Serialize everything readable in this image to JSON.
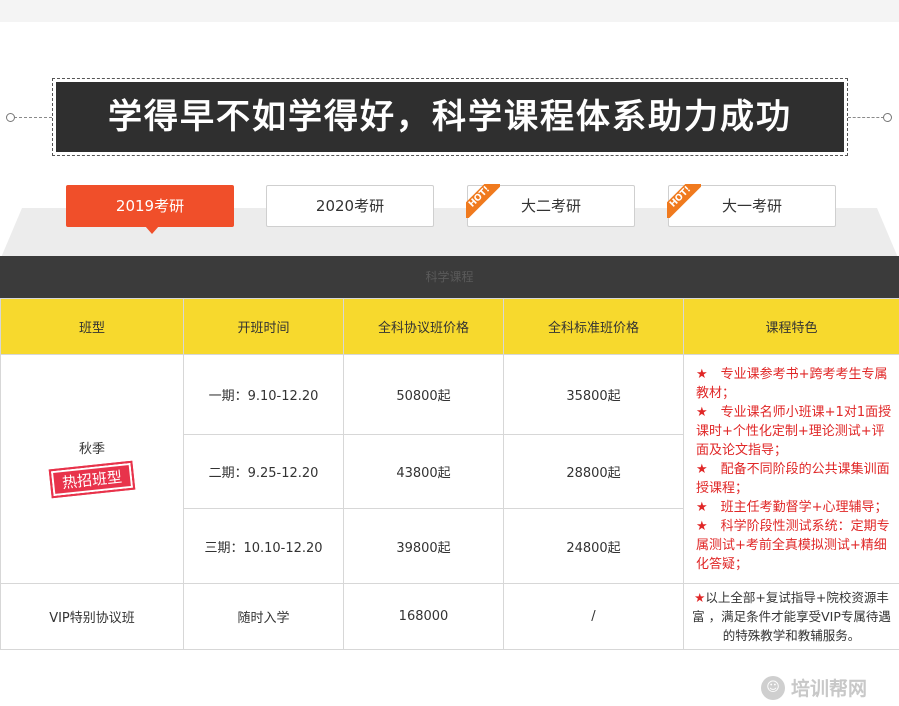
{
  "banner": {
    "title": "学得早不如学得好，科学课程体系助力成功"
  },
  "tabs": [
    {
      "label": "2019考研",
      "active": true,
      "hot": false
    },
    {
      "label": "2020考研",
      "active": false,
      "hot": false
    },
    {
      "label": "大二考研",
      "active": false,
      "hot": true
    },
    {
      "label": "大一考研",
      "active": false,
      "hot": true
    }
  ],
  "hot_badge": "HOT!",
  "section": {
    "title": "科学课程"
  },
  "table": {
    "headers": [
      "班型",
      "开班时间",
      "全科协议班价格",
      "全科标准班价格",
      "课程特色"
    ],
    "season": {
      "label": "秋季",
      "stamp": "热招班型"
    },
    "rows": [
      {
        "time": "一期：9.10-12.20",
        "protocol_price": "50800起",
        "standard_price": "35800起"
      },
      {
        "time": "二期：9.25-12.20",
        "protocol_price": "43800起",
        "standard_price": "28800起"
      },
      {
        "time": "三期：10.10-12.20",
        "protocol_price": "39800起",
        "standard_price": "24800起"
      }
    ],
    "features": [
      "★　专业课参考书+跨考考生专属教材；",
      "★　专业课名师小班课+1对1面授课时+个性化定制+理论测试+评面及论文指导；",
      "★　配备不同阶段的公共课集训面授课程；",
      "★　班主任考勤督学+心理辅导；",
      "★　科学阶段性测试系统：定期专属测试+考前全真模拟测试+精细化答疑；"
    ],
    "vip": {
      "name": "VIP特别协议班",
      "time": "随时入学",
      "protocol_price": "168000",
      "standard_price": "/",
      "feature_star": "★",
      "feature": "以上全部+复试指导+院校资源丰富 ，满足条件才能享受VIP专属待遇的特殊教学和教辅服务。"
    }
  },
  "watermark": {
    "text": "培训帮网",
    "icon": "smile-icon"
  },
  "colors": {
    "accent": "#f04f2a",
    "header_yellow": "#f7d92d",
    "feature_red": "#e02727",
    "dark_bar": "#3b3b3b"
  }
}
